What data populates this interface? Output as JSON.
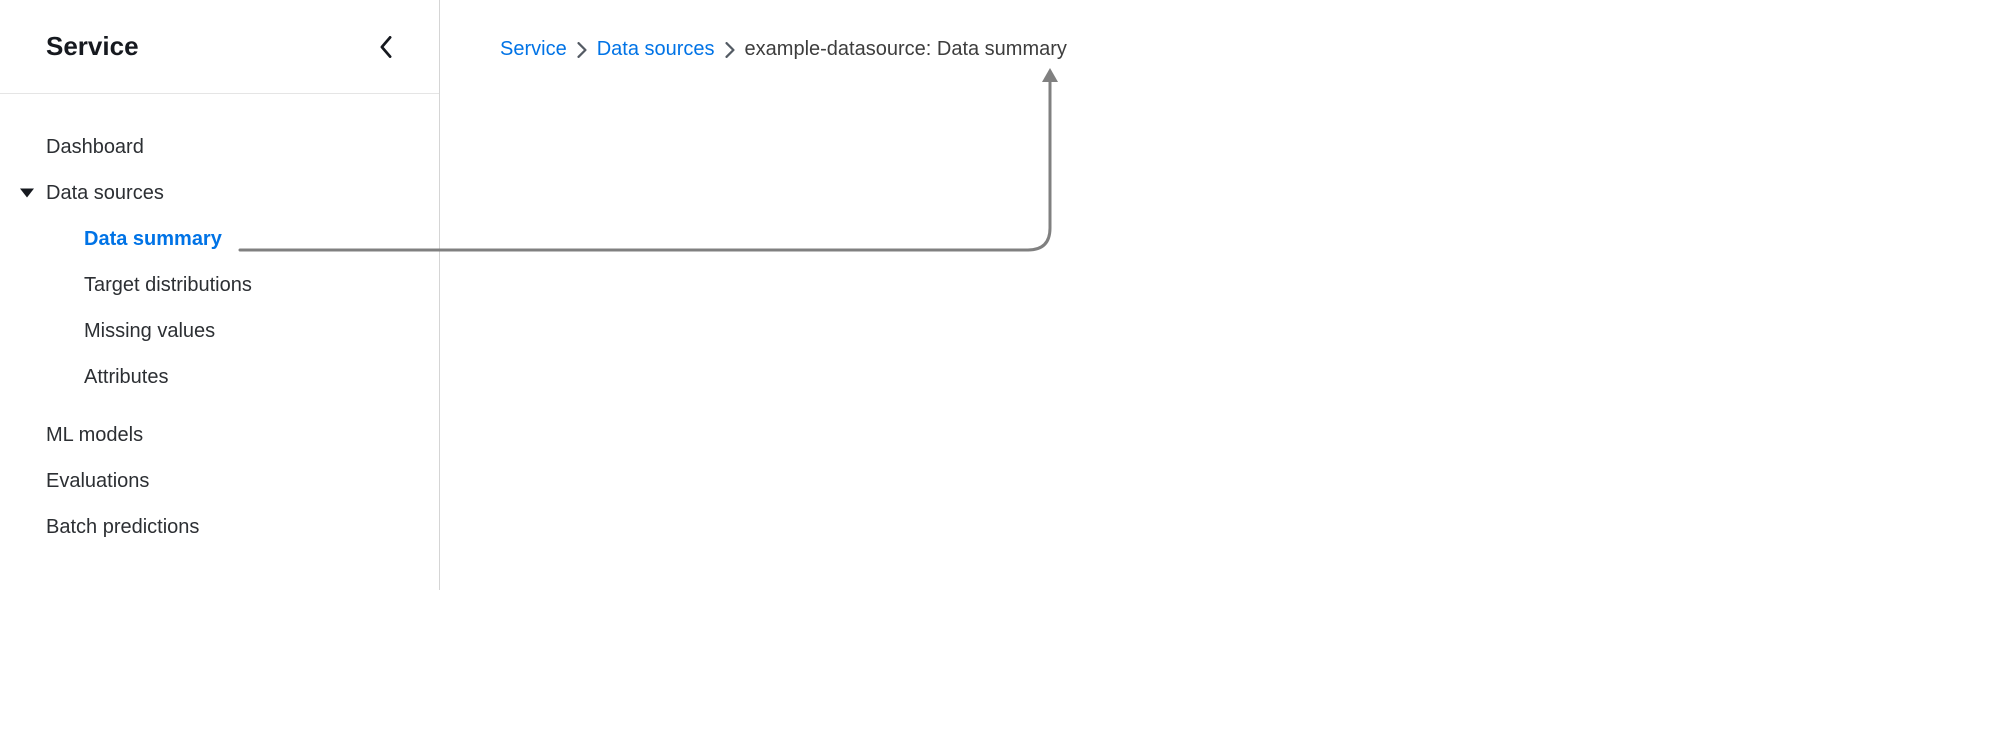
{
  "sidebar": {
    "title": "Service",
    "items": {
      "dashboard": "Dashboard",
      "data_sources": "Data sources",
      "ml_models": "ML models",
      "evaluations": "Evaluations",
      "batch_predictions": "Batch predictions"
    },
    "data_sources_children": {
      "data_summary": "Data summary",
      "target_distributions": "Target distributions",
      "missing_values": "Missing values",
      "attributes": "Attributes"
    }
  },
  "breadcrumb": {
    "service": "Service",
    "data_sources": "Data sources",
    "current": "example-datasource: Data summary"
  }
}
